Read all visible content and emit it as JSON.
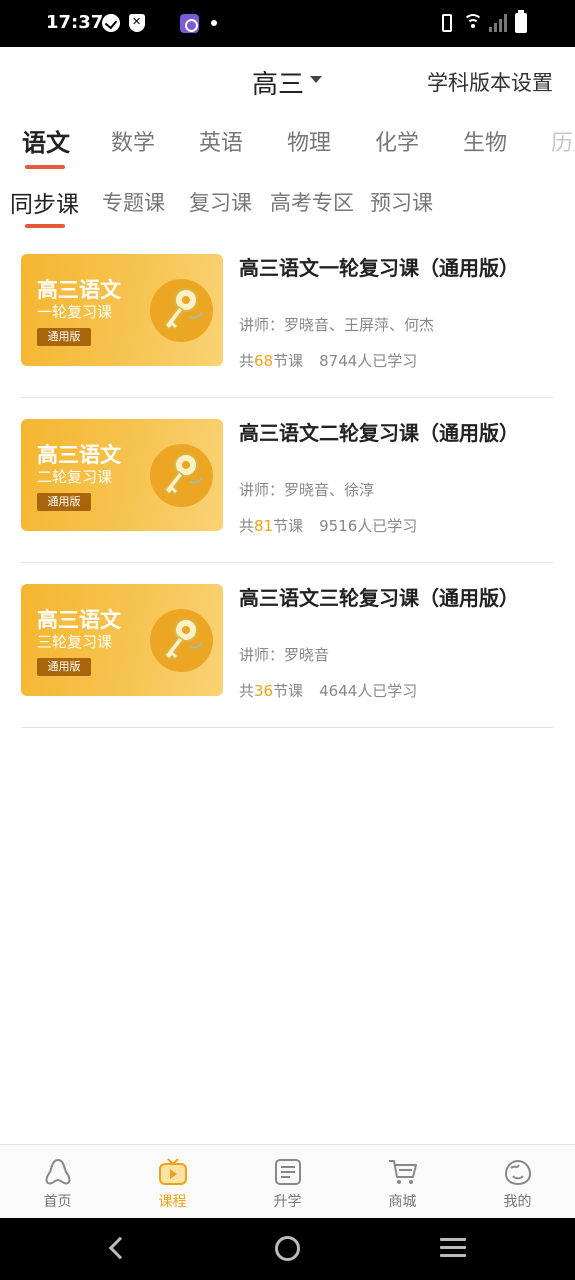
{
  "status_bar": {
    "time": "17:37"
  },
  "header": {
    "grade": "高三",
    "settings_label": "学科版本设置"
  },
  "subject_tabs": [
    "语文",
    "数学",
    "英语",
    "物理",
    "化学",
    "生物",
    "历史"
  ],
  "active_subject": "语文",
  "type_tabs": [
    "同步课",
    "专题课",
    "复习课",
    "高考专区",
    "预习课"
  ],
  "active_type": "同步课",
  "courses": [
    {
      "thumb_title": "高三语文",
      "thumb_sub": "一轮复习课",
      "thumb_badge": "通用版",
      "title": "高三语文一轮复习课（通用版）",
      "teacher": "讲师：罗晓音、王屏萍、何杰",
      "lessons_prefix": "共",
      "lessons_count": "68",
      "lessons_suffix": "节课",
      "learners": "8744人已学习"
    },
    {
      "thumb_title": "高三语文",
      "thumb_sub": "二轮复习课",
      "thumb_badge": "通用版",
      "title": "高三语文二轮复习课（通用版）",
      "teacher": "讲师：罗晓音、徐淳",
      "lessons_prefix": "共",
      "lessons_count": "81",
      "lessons_suffix": "节课",
      "learners": "9516人已学习"
    },
    {
      "thumb_title": "高三语文",
      "thumb_sub": "三轮复习课",
      "thumb_badge": "通用版",
      "title": "高三语文三轮复习课（通用版）",
      "teacher": "讲师：罗晓音",
      "lessons_prefix": "共",
      "lessons_count": "36",
      "lessons_suffix": "节课",
      "learners": "4644人已学习"
    }
  ],
  "bottom_nav": [
    {
      "label": "首页",
      "icon": "home-icon"
    },
    {
      "label": "课程",
      "icon": "course-play-icon",
      "active": true
    },
    {
      "label": "升学",
      "icon": "document-icon"
    },
    {
      "label": "商城",
      "icon": "cart-icon"
    },
    {
      "label": "我的",
      "icon": "face-icon"
    }
  ],
  "colors": {
    "accent": "#f0a216",
    "tab_underline": "#e55a3c",
    "thumb_gradient_start": "#f4b630",
    "thumb_gradient_end": "#f9d376"
  }
}
